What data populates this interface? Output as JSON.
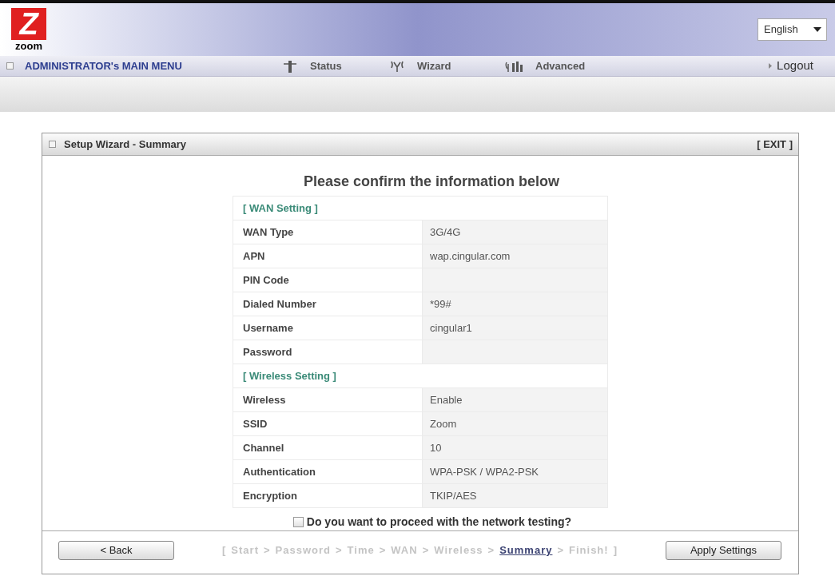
{
  "header": {
    "logo": {
      "mark": "Z",
      "text": "zoom"
    },
    "language_select": {
      "value": "English"
    }
  },
  "nav": {
    "title": "ADMINISTRATOR's MAIN MENU",
    "items": [
      {
        "label": "Status"
      },
      {
        "label": "Wizard"
      },
      {
        "label": "Advanced"
      }
    ],
    "logout": "Logout"
  },
  "panel": {
    "title": "Setup Wizard - Summary",
    "exit": "[ EXIT ]",
    "heading": "Please confirm the information below",
    "sections": [
      {
        "title": "[ WAN Setting ]",
        "rows": [
          {
            "label": "WAN Type",
            "value": "3G/4G"
          },
          {
            "label": "APN",
            "value": "wap.cingular.com"
          },
          {
            "label": "PIN Code"
          },
          {
            "label": "Dialed Number",
            "value": "*99#"
          },
          {
            "label": "Username",
            "value": "cingular1"
          },
          {
            "label": "Password"
          }
        ]
      },
      {
        "title": "[ Wireless Setting ]",
        "rows": [
          {
            "label": "Wireless",
            "value": "Enable"
          },
          {
            "label": "SSID",
            "value": "Zoom"
          },
          {
            "label": "Channel",
            "value": "10"
          },
          {
            "label": "Authentication",
            "value": "WPA-PSK / WPA2-PSK"
          },
          {
            "label": "Encryption",
            "value": "TKIP/AES"
          }
        ]
      }
    ],
    "network_test": {
      "label": "Do you want to proceed with the network testing?",
      "checked": false
    },
    "back_button": "< Back",
    "steps": [
      {
        "kind": "bracket",
        "text": "["
      },
      {
        "kind": "step",
        "text": "Start",
        "selected": false
      },
      {
        "kind": "separator",
        "text": ">"
      },
      {
        "kind": "step",
        "text": "Password",
        "selected": false
      },
      {
        "kind": "separator",
        "text": ">"
      },
      {
        "kind": "step",
        "text": "Time",
        "selected": false
      },
      {
        "kind": "separator",
        "text": ">"
      },
      {
        "kind": "step",
        "text": "WAN",
        "selected": false
      },
      {
        "kind": "separator",
        "text": ">"
      },
      {
        "kind": "step",
        "text": "Wireless",
        "selected": false
      },
      {
        "kind": "separator",
        "text": ">"
      },
      {
        "kind": "step",
        "text": "Summary",
        "selected": true
      },
      {
        "kind": "separator",
        "text": ">"
      },
      {
        "kind": "step",
        "text": "Finish!",
        "selected": false
      },
      {
        "kind": "bracket",
        "text": "]"
      }
    ],
    "apply_button": "Apply Settings"
  }
}
